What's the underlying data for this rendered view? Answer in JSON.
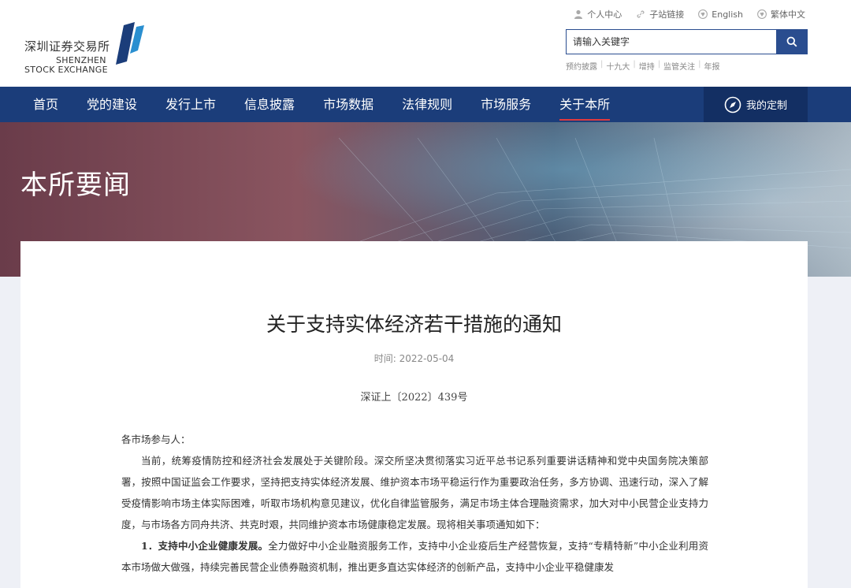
{
  "logo": {
    "cn": "深圳证券交易所",
    "en_line1": "SHENZHEN",
    "en_line2": "STOCK EXCHANGE"
  },
  "util_links": [
    {
      "label": "个人中心",
      "icon": "person-icon"
    },
    {
      "label": "子站链接",
      "icon": "link-icon"
    },
    {
      "label": "English",
      "icon": "globe-icon"
    },
    {
      "label": "繁体中文",
      "icon": "globe-icon"
    }
  ],
  "search": {
    "placeholder": "请输入关键字"
  },
  "hot_links": [
    "预约披露",
    "十九大",
    "增持",
    "监管关注",
    "年报"
  ],
  "nav": {
    "items": [
      "首页",
      "党的建设",
      "发行上市",
      "信息披露",
      "市场数据",
      "法律规则",
      "市场服务",
      "关于本所"
    ],
    "active_index": 7,
    "custom_label": "我的定制"
  },
  "banner": {
    "title": "本所要闻"
  },
  "article": {
    "title": "关于支持实体经济若干措施的通知",
    "date_label": "时间:",
    "date": "2022-05-04",
    "doc_no": "深证上〔2022〕439号",
    "salutation": "各市场参与人：",
    "para1": "当前，统筹疫情防控和经济社会发展处于关键阶段。深交所坚决贯彻落实习近平总书记系列重要讲话精神和党中央国务院决策部署，按照中国证监会工作要求，坚持把支持实体经济发展、维护资本市场平稳运行作为重要政治任务，多方协调、迅速行动，深入了解受疫情影响市场主体实际困难，听取市场机构意见建议，优化自律监管服务，满足市场主体合理融资需求，加大对中小民营企业支持力度，与市场各方同舟共济、共克时艰，共同维护资本市场健康稳定发展。现将相关事项通知如下：",
    "item1_heading": "1．支持中小企业健康发展。",
    "item1_text": "全力做好中小企业融资服务工作，支持中小企业疫后生产经营恢复，支持“专精特新”中小企业利用资本市场做大做强，持续完善民营企业债券融资机制，推出更多直达实体经济的创新产品，支持中小企业平稳健康发"
  },
  "colors": {
    "nav_bg": "#1b3d7a",
    "nav_active_underline": "#e0393e",
    "search_btn": "#2a4d8f"
  }
}
